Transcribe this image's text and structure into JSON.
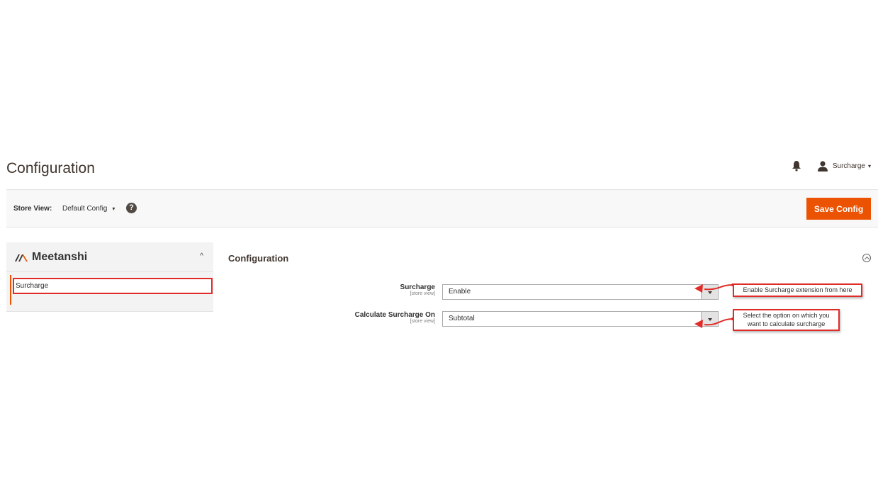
{
  "header": {
    "title": "Configuration",
    "user_name": "Surcharge",
    "caret": "▾"
  },
  "store_bar": {
    "label": "Store View:",
    "selected_scope": "Default Config",
    "help_glyph": "?",
    "save_label": "Save Config"
  },
  "sidebar": {
    "brand": "Meetanshi",
    "collapse_glyph": "^",
    "items": [
      {
        "label": "Surcharge"
      }
    ]
  },
  "section": {
    "title": "Configuration",
    "fields": [
      {
        "label": "Surcharge",
        "scope": "[store view]",
        "value": "Enable"
      },
      {
        "label": "Calculate Surcharge On",
        "scope": "[store view]",
        "value": "Subtotal"
      }
    ]
  },
  "annotations": [
    {
      "text": "Enable Surcharge extension from here"
    },
    {
      "text_line1": "Select the option on which you",
      "text_line2": "want to calculate surcharge"
    }
  ],
  "colors": {
    "accent": "#eb5202",
    "annotation": "#e02b27"
  }
}
